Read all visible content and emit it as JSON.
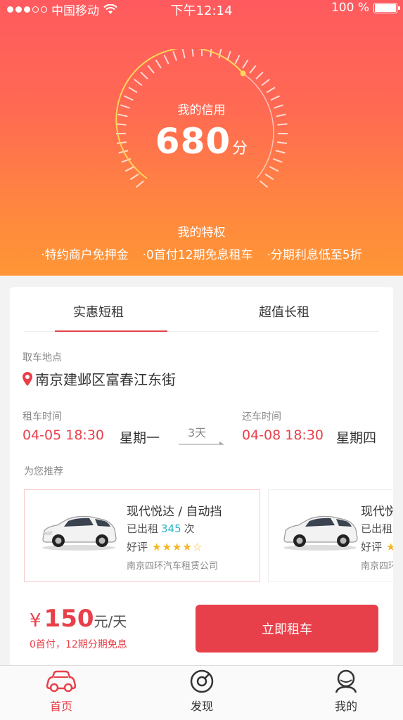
{
  "status_bar": {
    "carrier": "中国移动",
    "time": "下午12:14",
    "battery": "100 %"
  },
  "credit": {
    "label": "我的信用",
    "score": "680",
    "unit": "分"
  },
  "privileges": {
    "title": "我的特权",
    "items": [
      "·特约商户免押金",
      "·0首付12期免息租车",
      "·分期利息低至5折"
    ]
  },
  "tabs": [
    "实惠短租",
    "超值长租"
  ],
  "pickup": {
    "label": "取车地点",
    "value": "南京建邺区富春江东街"
  },
  "rental": {
    "rent_label": "租车时间",
    "rent_time": "04-05 18:30",
    "rent_weekday": "星期一",
    "days": "3天",
    "return_label": "还车时间",
    "return_time": "04-08 18:30",
    "return_weekday": "星期四"
  },
  "recommend": {
    "title": "为您推荐",
    "cars": [
      {
        "name": "现代悦达 / 自动挡",
        "rented_prefix": "已出租",
        "rented_count": "345",
        "rented_suffix": "次",
        "rating_label": "好评",
        "stars": 4,
        "company": "南京四环汽车租赁公司"
      },
      {
        "name": "现代悦",
        "rented_prefix": "已出租",
        "rating_label": "好评",
        "company": "南京四环"
      }
    ]
  },
  "price": {
    "currency": "¥",
    "amount": "150",
    "unit": "元/天",
    "note": "0首付，12期分期免息"
  },
  "rent_button": "立即租车",
  "tab_bar": [
    "首页",
    "发现",
    "我的"
  ],
  "colors": {
    "accent": "#e8404a",
    "teal": "#2ab3c5",
    "star": "#f5b623"
  }
}
